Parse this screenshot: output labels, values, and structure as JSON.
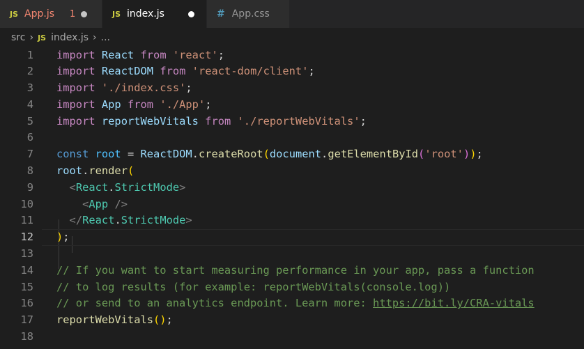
{
  "tabs": [
    {
      "icon": "JS",
      "label": "App.js",
      "problems": "1",
      "modified": true,
      "active": false
    },
    {
      "icon": "JS",
      "label": "index.js",
      "modified": true,
      "active": true
    },
    {
      "icon": "#",
      "label": "App.css",
      "active": false
    }
  ],
  "breadcrumb": {
    "folder": "src",
    "file_icon": "JS",
    "file": "index.js",
    "symbol": "..."
  },
  "editor": {
    "current_line": 12,
    "lines": [
      {
        "n": "1",
        "tokens": [
          [
            "kw2",
            "import"
          ],
          [
            "pun",
            " "
          ],
          [
            "var",
            "React"
          ],
          [
            "pun",
            " "
          ],
          [
            "kw2",
            "from"
          ],
          [
            "pun",
            " "
          ],
          [
            "str",
            "'react'"
          ],
          [
            "pun",
            ";"
          ]
        ]
      },
      {
        "n": "2",
        "tokens": [
          [
            "kw2",
            "import"
          ],
          [
            "pun",
            " "
          ],
          [
            "var",
            "ReactDOM"
          ],
          [
            "pun",
            " "
          ],
          [
            "kw2",
            "from"
          ],
          [
            "pun",
            " "
          ],
          [
            "str",
            "'react-dom/client'"
          ],
          [
            "pun",
            ";"
          ]
        ]
      },
      {
        "n": "3",
        "tokens": [
          [
            "kw2",
            "import"
          ],
          [
            "pun",
            " "
          ],
          [
            "str",
            "'./index.css'"
          ],
          [
            "pun",
            ";"
          ]
        ]
      },
      {
        "n": "4",
        "tokens": [
          [
            "kw2",
            "import"
          ],
          [
            "pun",
            " "
          ],
          [
            "var",
            "App"
          ],
          [
            "pun",
            " "
          ],
          [
            "kw2",
            "from"
          ],
          [
            "pun",
            " "
          ],
          [
            "str",
            "'./App'"
          ],
          [
            "pun",
            ";"
          ]
        ]
      },
      {
        "n": "5",
        "tokens": [
          [
            "kw2",
            "import"
          ],
          [
            "pun",
            " "
          ],
          [
            "var",
            "reportWebVitals"
          ],
          [
            "pun",
            " "
          ],
          [
            "kw2",
            "from"
          ],
          [
            "pun",
            " "
          ],
          [
            "str",
            "'./reportWebVitals'"
          ],
          [
            "pun",
            ";"
          ]
        ]
      },
      {
        "n": "6",
        "tokens": []
      },
      {
        "n": "7",
        "tokens": [
          [
            "kw",
            "const"
          ],
          [
            "pun",
            " "
          ],
          [
            "const",
            "root"
          ],
          [
            "pun",
            " = "
          ],
          [
            "var",
            "ReactDOM"
          ],
          [
            "pun",
            "."
          ],
          [
            "fn",
            "createRoot"
          ],
          [
            "p1",
            "("
          ],
          [
            "var",
            "document"
          ],
          [
            "pun",
            "."
          ],
          [
            "fn",
            "getElementById"
          ],
          [
            "p2",
            "("
          ],
          [
            "str",
            "'root'"
          ],
          [
            "p2",
            ")"
          ],
          [
            "p1",
            ")"
          ],
          [
            "pun",
            ";"
          ]
        ]
      },
      {
        "n": "8",
        "tokens": [
          [
            "var",
            "root"
          ],
          [
            "pun",
            "."
          ],
          [
            "fn",
            "render"
          ],
          [
            "p1",
            "("
          ]
        ]
      },
      {
        "n": "9",
        "tokens": [
          [
            "pun",
            "  "
          ],
          [
            "tag",
            "<"
          ],
          [
            "comp",
            "React"
          ],
          [
            "pun",
            "."
          ],
          [
            "comp",
            "StrictMode"
          ],
          [
            "tag",
            ">"
          ]
        ]
      },
      {
        "n": "10",
        "tokens": [
          [
            "pun",
            "    "
          ],
          [
            "tag",
            "<"
          ],
          [
            "comp",
            "App"
          ],
          [
            "pun",
            " "
          ],
          [
            "tag",
            "/>"
          ]
        ]
      },
      {
        "n": "11",
        "tokens": [
          [
            "pun",
            "  "
          ],
          [
            "tag",
            "</"
          ],
          [
            "comp",
            "React"
          ],
          [
            "pun",
            "."
          ],
          [
            "comp",
            "StrictMode"
          ],
          [
            "tag",
            ">"
          ]
        ]
      },
      {
        "n": "12",
        "tokens": [
          [
            "p1",
            ")"
          ],
          [
            "pun",
            ";"
          ]
        ]
      },
      {
        "n": "13",
        "tokens": []
      },
      {
        "n": "14",
        "tokens": [
          [
            "cmt",
            "// If you want to start measuring performance in your app, pass a function"
          ]
        ]
      },
      {
        "n": "15",
        "tokens": [
          [
            "cmt",
            "// to log results (for example: reportWebVitals(console.log))"
          ]
        ]
      },
      {
        "n": "16",
        "tokens": [
          [
            "cmt",
            "// or send to an analytics endpoint. Learn more: "
          ],
          [
            "cmt link",
            "https://bit.ly/CRA-vitals"
          ]
        ]
      },
      {
        "n": "17",
        "tokens": [
          [
            "fn",
            "reportWebVitals"
          ],
          [
            "p1",
            "()"
          ],
          [
            "pun",
            ";"
          ]
        ]
      },
      {
        "n": "18",
        "tokens": []
      }
    ]
  }
}
